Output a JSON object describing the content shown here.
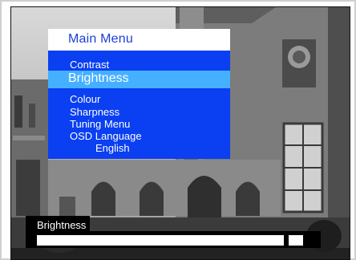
{
  "menu": {
    "title": "Main Menu",
    "items": [
      {
        "label": "Contrast"
      },
      {
        "label": "Brightness",
        "selected": true
      },
      {
        "label": "Colour"
      },
      {
        "label": "Sharpness"
      },
      {
        "label": "Tuning Menu"
      },
      {
        "label": "OSD Language"
      },
      {
        "label": "English"
      }
    ]
  },
  "status": {
    "label": "Brightness",
    "level": 0.88
  },
  "colors": {
    "menu_background": "#0a3ff2",
    "selected_highlight": "#45b0ff",
    "title_text": "#1a3fd6"
  }
}
